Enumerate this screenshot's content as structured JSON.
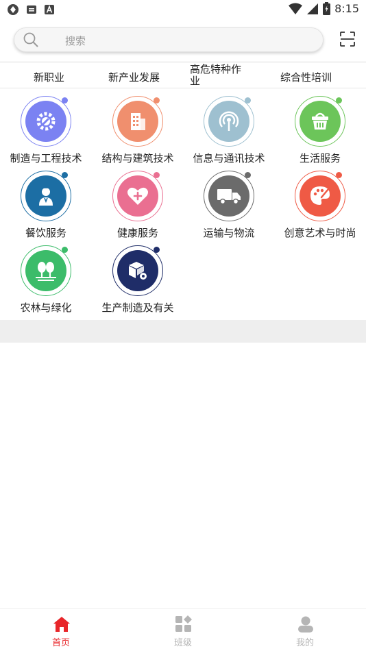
{
  "status_bar": {
    "time": "8:15",
    "icons": [
      "app-icon",
      "mail-icon",
      "font-icon",
      "wifi-icon",
      "signal-icon",
      "battery-icon"
    ]
  },
  "search": {
    "placeholder": "搜索",
    "icon": "search-icon",
    "scan_icon": "scan-icon"
  },
  "tabs": [
    "新职业",
    "新产业发展",
    "高危特种作业",
    "综合性培训"
  ],
  "categories": [
    {
      "label": "制造与工程技术",
      "icon": "gear-wrench-icon",
      "color": "#7b82f2",
      "dot": "#7b82f2"
    },
    {
      "label": "结构与建筑技术",
      "icon": "building-icon",
      "color": "#f08f6e",
      "dot": "#f08f6e"
    },
    {
      "label": "信息与通讯技术",
      "icon": "antenna-icon",
      "color": "#9ec0d0",
      "dot": "#9ec0d0"
    },
    {
      "label": "生活服务",
      "icon": "basket-icon",
      "color": "#6cc55a",
      "dot": "#6cc55a"
    },
    {
      "label": "餐饮服务",
      "icon": "chef-icon",
      "color": "#1c6ea4",
      "dot": "#1c6ea4"
    },
    {
      "label": "健康服务",
      "icon": "heart-plus-icon",
      "color": "#ea6f91",
      "dot": "#ea6f91"
    },
    {
      "label": "运输与物流",
      "icon": "truck-icon",
      "color": "#6b6b6b",
      "dot": "#6b6b6b"
    },
    {
      "label": "创意艺术与时尚",
      "icon": "palette-icon",
      "color": "#ef5a45",
      "dot": "#ef5a45"
    },
    {
      "label": "农林与绿化",
      "icon": "trees-icon",
      "color": "#3cbc6a",
      "dot": "#3cbc6a"
    },
    {
      "label": "生产制造及有关",
      "icon": "box-gear-icon",
      "color": "#1f2d68",
      "dot": "#1f2d68"
    }
  ],
  "bottom_nav": [
    {
      "label": "首页",
      "icon": "home-icon",
      "active": true
    },
    {
      "label": "班级",
      "icon": "class-grid-icon",
      "active": false
    },
    {
      "label": "我的",
      "icon": "user-icon",
      "active": false
    }
  ],
  "colors": {
    "accent": "#e8262a",
    "inactive": "#b5b5b5"
  }
}
